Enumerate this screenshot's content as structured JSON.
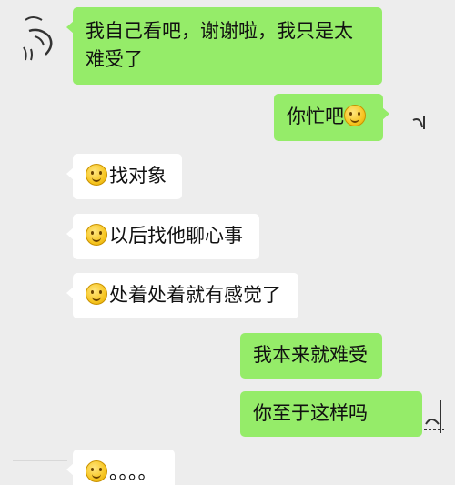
{
  "messages": [
    {
      "id": "m1",
      "side": "left",
      "style": "green",
      "text": "我自己看吧，谢谢啦，我只是太难受了"
    },
    {
      "id": "m2",
      "side": "right",
      "style": "green",
      "text": "你忙吧",
      "emoji_after": true
    },
    {
      "id": "m3",
      "side": "left",
      "style": "white",
      "text": "找对象",
      "emoji_before": true
    },
    {
      "id": "m4",
      "side": "left",
      "style": "white",
      "text": "以后找他聊心事",
      "emoji_before": true
    },
    {
      "id": "m5",
      "side": "left",
      "style": "white",
      "text": "处着处着就有感觉了",
      "emoji_before": true
    },
    {
      "id": "m6",
      "side": "right",
      "style": "green",
      "text": "我本来就难受"
    },
    {
      "id": "m7",
      "side": "right",
      "style": "green",
      "text": "你至于这样吗"
    },
    {
      "id": "m8",
      "side": "left",
      "style": "white",
      "text": "。。。。",
      "emoji_before": true
    }
  ],
  "icons": {
    "emoji": "smiley-emoji-icon",
    "voice": "voice-wave-icon"
  },
  "colors": {
    "background": "#ededed",
    "sent_bubble": "#95ec69",
    "received_bubble": "#ffffff"
  }
}
